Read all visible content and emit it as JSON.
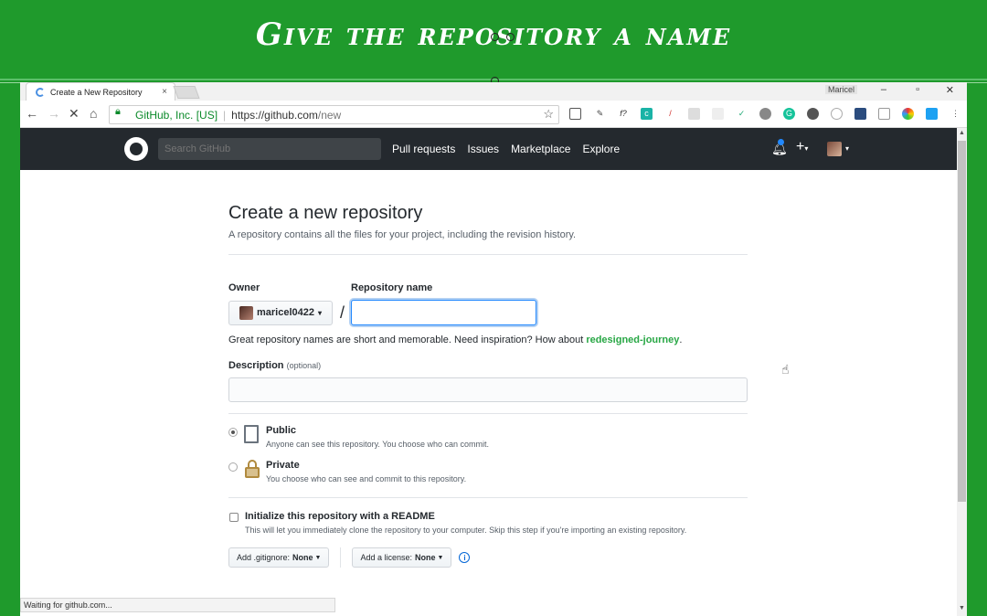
{
  "banner": {
    "title": "Give the repository a name"
  },
  "browser": {
    "tab_title": "Create a New Repository",
    "tab_close": "×",
    "window_user": "Maricel",
    "win_min": "–",
    "win_max": "▫",
    "win_close": "✕",
    "omnibox": {
      "secure_label": "GitHub, Inc. [US]",
      "url_host": "https://github.com",
      "url_path": "/new"
    },
    "status_text": "Waiting for github.com..."
  },
  "github_header": {
    "search_placeholder": "Search GitHub",
    "nav": [
      "Pull requests",
      "Issues",
      "Marketplace",
      "Explore"
    ],
    "plus": "+"
  },
  "form": {
    "title": "Create a new repository",
    "subtitle": "A repository contains all the files for your project, including the revision history.",
    "owner_label": "Owner",
    "repo_label": "Repository name",
    "owner_value": "maricel0422",
    "slash": "/",
    "repo_value": "",
    "hint_prefix": "Great repository names are short and memorable. Need inspiration? How about ",
    "hint_suggestion": "redesigned-journey",
    "hint_suffix": ".",
    "description_label": "Description",
    "description_optional": "(optional)",
    "description_value": "",
    "visibility": [
      {
        "title": "Public",
        "desc": "Anyone can see this repository. You choose who can commit.",
        "checked": true
      },
      {
        "title": "Private",
        "desc": "You choose who can see and commit to this repository.",
        "checked": false
      }
    ],
    "readme_title": "Initialize this repository with a README",
    "readme_desc": "This will let you immediately clone the repository to your computer. Skip this step if you're importing an existing repository.",
    "gitignore_label": "Add .gitignore:",
    "gitignore_value": "None",
    "license_label": "Add a license:",
    "license_value": "None",
    "info": "i"
  },
  "colors": {
    "banner_green": "#1f9a2c",
    "github_header": "#24292e",
    "suggestion_green": "#28a745",
    "focus_blue": "#2188ff"
  }
}
